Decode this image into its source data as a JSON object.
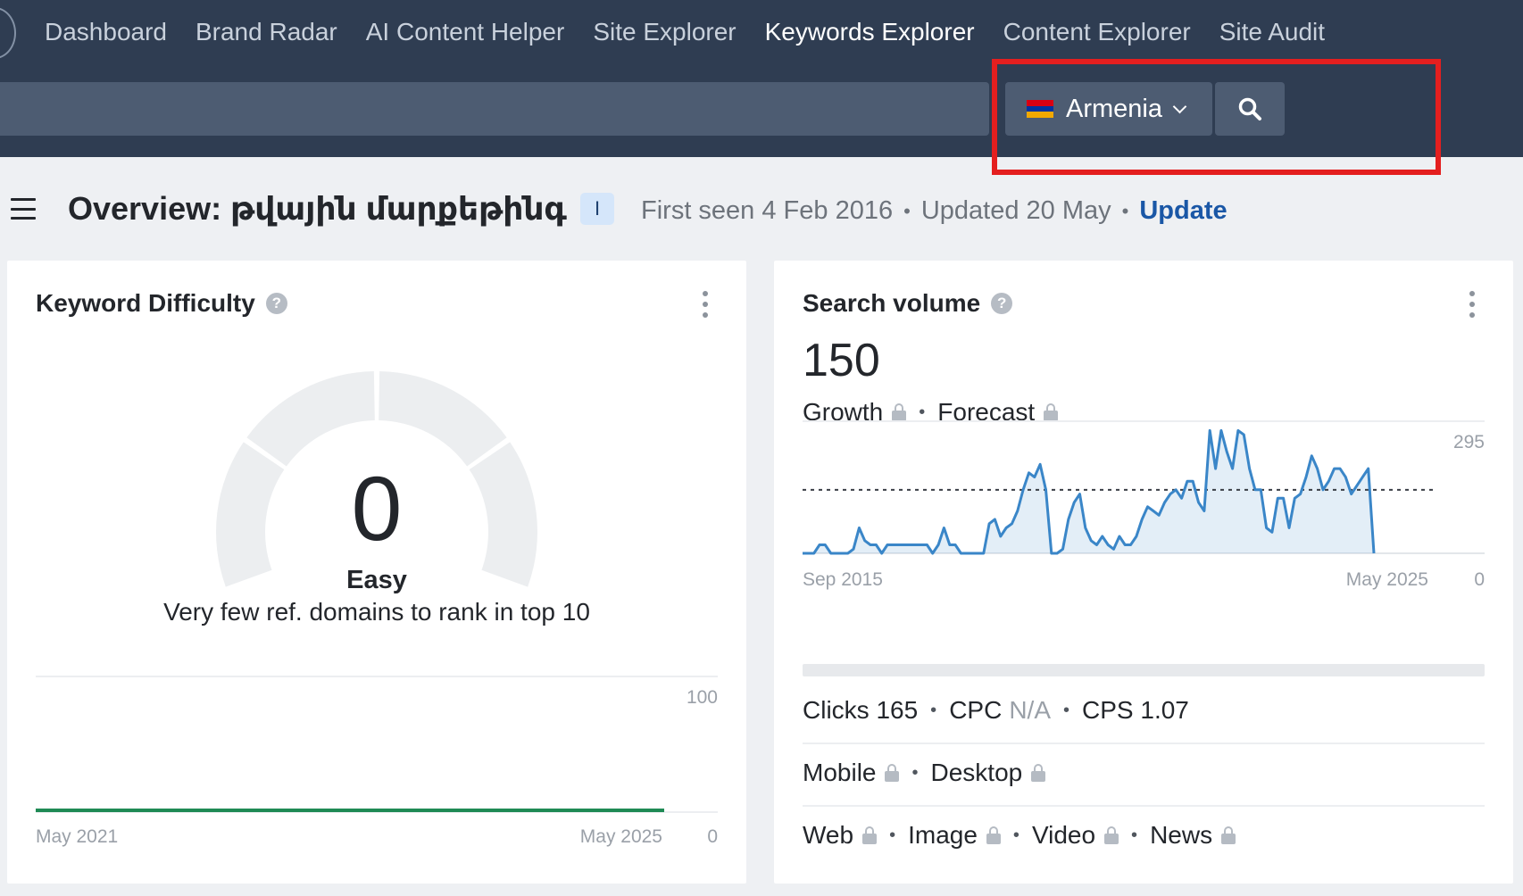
{
  "nav": {
    "items": [
      {
        "label": "Dashboard",
        "active": false
      },
      {
        "label": "Brand Radar",
        "active": false
      },
      {
        "label": "AI Content Helper",
        "active": false
      },
      {
        "label": "Site Explorer",
        "active": false
      },
      {
        "label": "Keywords Explorer",
        "active": true
      },
      {
        "label": "Content Explorer",
        "active": false
      },
      {
        "label": "Site Audit",
        "active": false
      }
    ]
  },
  "search": {
    "country": "Armenia",
    "flag_colors": [
      "#d90012",
      "#0033a0",
      "#f2a800"
    ],
    "search_icon": "search-icon",
    "highlight_color": "#e41f1f"
  },
  "overview": {
    "title": "Overview: թվային մարքեթինգ",
    "badge": "I",
    "first_seen": "First seen 4 Feb 2016",
    "updated": "Updated 20 May",
    "update_link": "Update"
  },
  "keyword_difficulty": {
    "title": "Keyword Difficulty",
    "help_icon": "help-icon",
    "value": "0",
    "label": "Easy",
    "description": "Very few ref. domains to rank in top 10",
    "chart": {
      "y_max_label": "100",
      "y_min_label": "0",
      "x_start_label": "May 2021",
      "x_end_label": "May 2025",
      "line_color": "#1f8a55"
    }
  },
  "search_volume": {
    "title": "Search volume",
    "help_icon": "help-icon",
    "value": "150",
    "growth": "Growth",
    "forecast": "Forecast",
    "clicks": "Clicks 165",
    "cpc_label": "CPC",
    "cpc_value": "N/A",
    "cps": "CPS 1.07",
    "mobile": "Mobile",
    "desktop": "Desktop",
    "web": "Web",
    "image": "Image",
    "video": "Video",
    "news": "News",
    "lock_icon": "lock-icon",
    "accent_color": "#3a86c8"
  },
  "chart_data": {
    "type": "area",
    "xlabel": "",
    "ylabel": "",
    "x_start_label": "Sep 2015",
    "x_end_label": "May 2025",
    "y_max_label": "295",
    "y_min_label": "0",
    "ylim": [
      0,
      295
    ],
    "average_line": 150,
    "grid": true,
    "series": [
      {
        "values": [
          0,
          0,
          0,
          20,
          20,
          0,
          0,
          0,
          0,
          10,
          60,
          30,
          20,
          20,
          0,
          20,
          20,
          20,
          20,
          20,
          20,
          20,
          20,
          0,
          20,
          60,
          20,
          20,
          0,
          0,
          0,
          0,
          0,
          70,
          80,
          40,
          60,
          70,
          100,
          150,
          190,
          180,
          210,
          150,
          0,
          0,
          10,
          80,
          120,
          140,
          60,
          30,
          20,
          40,
          20,
          10,
          40,
          20,
          20,
          40,
          80,
          110,
          100,
          90,
          120,
          140,
          150,
          130,
          170,
          170,
          120,
          100,
          290,
          200,
          290,
          240,
          200,
          290,
          280,
          200,
          150,
          150,
          60,
          50,
          130,
          130,
          60,
          130,
          140,
          180,
          230,
          200,
          150,
          170,
          200,
          200,
          180,
          140,
          160,
          180,
          200,
          0
        ]
      }
    ]
  }
}
